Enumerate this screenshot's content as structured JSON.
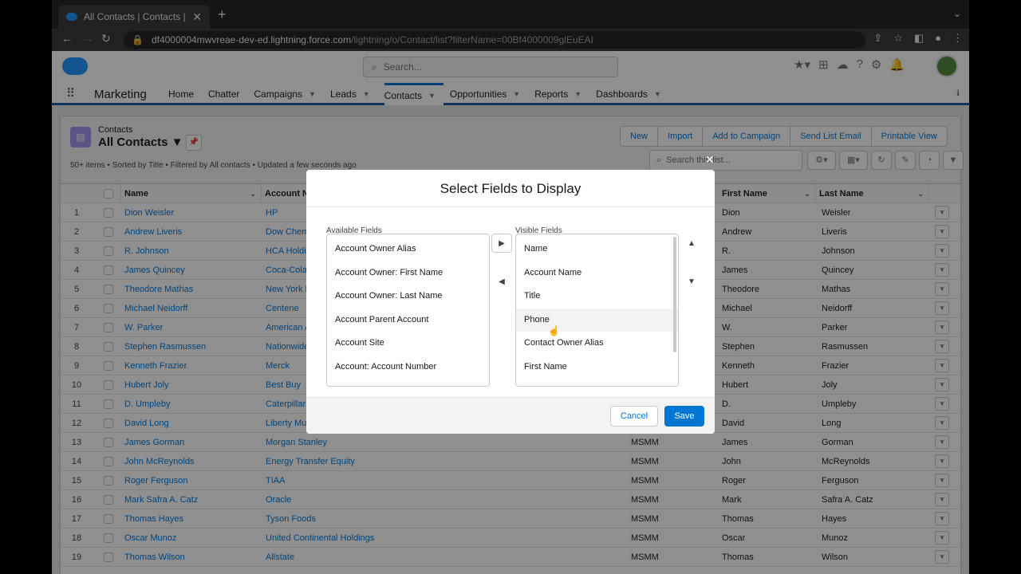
{
  "browser": {
    "tab_title": "All Contacts | Contacts | Salesf",
    "url_host": "df4000004mwvreae-dev-ed.lightning.force.com",
    "url_path": "/lightning/o/Contact/list?filterName=00Bf4000009glEuEAI"
  },
  "header": {
    "search_placeholder": "Search..."
  },
  "nav": {
    "app": "Marketing",
    "items": [
      "Home",
      "Chatter",
      "Campaigns",
      "Leads",
      "Contacts",
      "Opportunities",
      "Reports",
      "Dashboards"
    ]
  },
  "list": {
    "object": "Contacts",
    "view": "All Contacts",
    "meta": "50+ items • Sorted by Title • Filtered by All contacts • Updated a few seconds ago",
    "search_placeholder": "Search this list...",
    "buttons": [
      "New",
      "Import",
      "Add to Campaign",
      "Send List Email",
      "Printable View"
    ],
    "columns": [
      "Name",
      "Account N",
      "First Name",
      "Last Name"
    ],
    "rows": [
      [
        "1",
        "Dion Weisler",
        "HP",
        "",
        "Dion",
        "Weisler"
      ],
      [
        "2",
        "Andrew Liveris",
        "Dow Chem",
        "",
        "Andrew",
        "Liveris"
      ],
      [
        "3",
        "R. Johnson",
        "HCA Holdir",
        "",
        "R.",
        "Johnson"
      ],
      [
        "4",
        "James Quincey",
        "Coca-Cola",
        "",
        "James",
        "Quincey"
      ],
      [
        "5",
        "Theodore Mathas",
        "New York L",
        "",
        "Theodore",
        "Mathas"
      ],
      [
        "6",
        "Michael Neidorff",
        "Centene",
        "",
        "Michael",
        "Neidorff"
      ],
      [
        "7",
        "W. Parker",
        "American A",
        "",
        "W.",
        "Parker"
      ],
      [
        "8",
        "Stephen Rasmussen",
        "Nationwide",
        "",
        "Stephen",
        "Rasmussen"
      ],
      [
        "9",
        "Kenneth Frazier",
        "Merck",
        "",
        "Kenneth",
        "Frazier"
      ],
      [
        "10",
        "Hubert Joly",
        "Best Buy",
        "",
        "Hubert",
        "Joly"
      ],
      [
        "11",
        "D. Umpleby",
        "Caterpillar",
        "",
        "D.",
        "Umpleby"
      ],
      [
        "12",
        "David Long",
        "Liberty Mu",
        "",
        "David",
        "Long"
      ],
      [
        "13",
        "James Gorman",
        "Morgan Stanley",
        "MSMM",
        "James",
        "Gorman"
      ],
      [
        "14",
        "John McReynolds",
        "Energy Transfer Equity",
        "MSMM",
        "John",
        "McReynolds"
      ],
      [
        "15",
        "Roger Ferguson",
        "TIAA",
        "MSMM",
        "Roger",
        "Ferguson"
      ],
      [
        "16",
        "Mark Safra A. Catz",
        "Oracle",
        "MSMM",
        "Mark",
        "Safra A. Catz"
      ],
      [
        "17",
        "Thomas Hayes",
        "Tyson Foods",
        "MSMM",
        "Thomas",
        "Hayes"
      ],
      [
        "18",
        "Oscar Munoz",
        "United Continental Holdings",
        "MSMM",
        "Oscar",
        "Munoz"
      ],
      [
        "19",
        "Thomas Wilson",
        "Allstate",
        "MSMM",
        "Thomas",
        "Wilson"
      ]
    ]
  },
  "modal": {
    "title": "Select Fields to Display",
    "available_label": "Available Fields",
    "visible_label": "Visible Fields",
    "available": [
      "Account Owner Alias",
      "Account Owner: First Name",
      "Account Owner: Last Name",
      "Account Parent Account",
      "Account Site",
      "Account: Account Number"
    ],
    "visible": [
      "Name",
      "Account Name",
      "Title",
      "Phone",
      "Contact Owner Alias",
      "First Name"
    ],
    "cancel": "Cancel",
    "save": "Save"
  }
}
